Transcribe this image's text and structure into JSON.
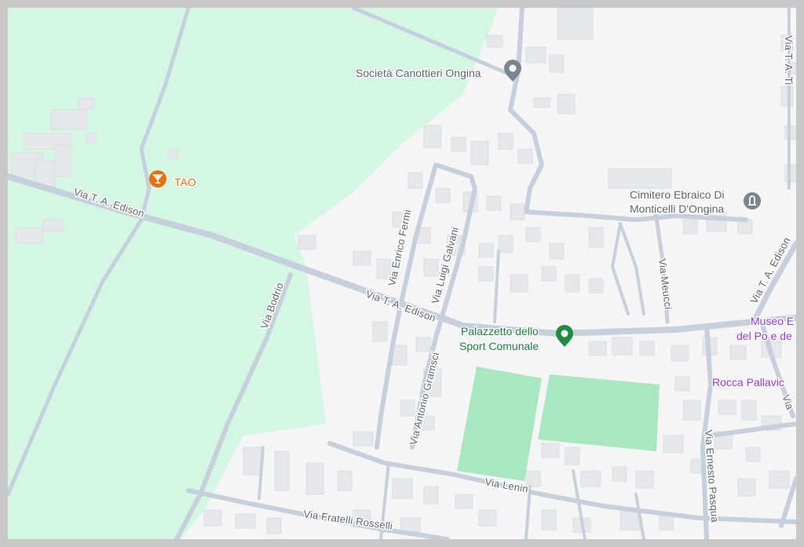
{
  "map": {
    "pois": [
      {
        "id": "societa",
        "name": "Società Canottieri Ongina",
        "icon": "map-pin-icon",
        "color": "#5f6368"
      },
      {
        "id": "tao",
        "name": "TAO",
        "icon": "cocktail-bar-icon",
        "color": "#e8710a"
      },
      {
        "id": "cimitero",
        "name_line1": "Cimitero Ebraico Di",
        "name_line2": "Monticelli D'Ongina",
        "icon": "cemetery-icon",
        "color": "#5f6368"
      },
      {
        "id": "palazzetto",
        "name_line1": "Palazzetto dello",
        "name_line2": "Sport Comunale",
        "icon": "sports-pin-icon",
        "color": "#188038"
      },
      {
        "id": "museo",
        "name_line1": "Museo E",
        "name_line2": "del Po e de",
        "color": "#9334e6"
      },
      {
        "id": "rocca",
        "name": "Rocca Pallavic",
        "color": "#9334e6"
      }
    ],
    "roads": {
      "edison_west": "Via T. A. Edison",
      "edison_mid": "Via T. A. Edison",
      "edison_east": "Via T. A. Edison",
      "bodrio": "Via Bodrio",
      "fermi": "Via Enrico Fermi",
      "galvani": "Via Luigi Galvani",
      "gramsci": "Via Antonio Gramsci",
      "mucci": "Via Meucci",
      "lenin": "Via Lenin",
      "rosselli": "Via Fratelli Rosselli",
      "pasquali": "Via Ernesto Pasqua",
      "edge_north": "Via T. A. Ti",
      "edge_east": "Via"
    },
    "colors": {
      "background": "#f5f5f6",
      "park": "#d4f7e4",
      "sports_field": "#a8e8c0",
      "road": "#c5d0dc",
      "building": "#e8e9ed"
    }
  }
}
